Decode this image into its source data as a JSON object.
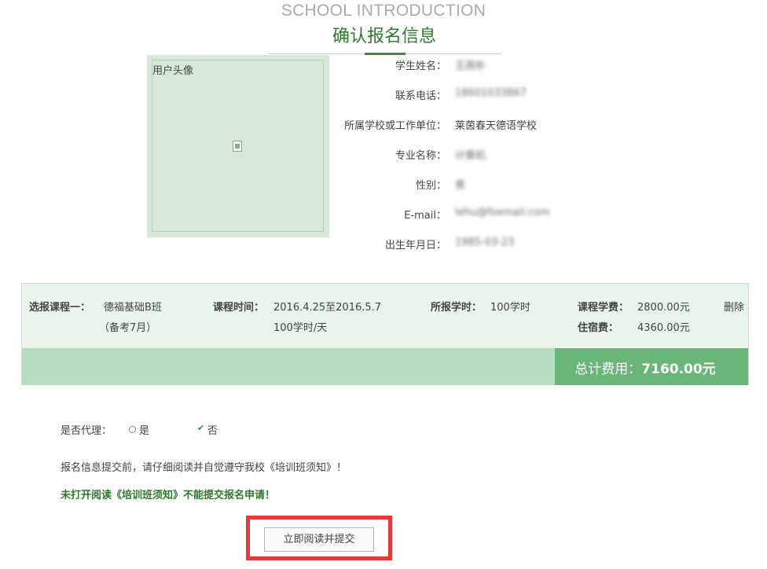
{
  "header": {
    "subtitle": "SCHOOL INTRODUCTION",
    "title": "确认报名信息"
  },
  "avatar": {
    "label": "用户头像"
  },
  "info": [
    {
      "label": "学生姓名：",
      "value": "王雨朴",
      "blurred": true
    },
    {
      "label": "联系电话：",
      "value": "18601033867",
      "blurred": true
    },
    {
      "label": "所属学校或工作单位：",
      "value": "莱茵春天德语学校",
      "blurred": false
    },
    {
      "label": "专业名称：",
      "value": "计算机",
      "blurred": true
    },
    {
      "label": "性别：",
      "value": "男",
      "blurred": true
    },
    {
      "label": "E-mail：",
      "value": "lehu@foxmail.com",
      "blurred": true
    },
    {
      "label": "出生年月日：",
      "value": "1985-03-23",
      "blurred": true
    }
  ],
  "course": {
    "course_label": "选报课程一：",
    "course_name": "德福基础B班",
    "course_note": "（备考7月）",
    "time_label": "课程时间：",
    "time_value": "2016.4.25至2016.5.7",
    "time_per_day": "100学时/天",
    "hours_label": "所报学时：",
    "hours_value": "100学时",
    "tuition_label": "课程学费：",
    "tuition_value": "2800.00元",
    "lodging_label": "住宿费：",
    "lodging_value": "4360.00元",
    "delete_label": "删除"
  },
  "total": {
    "label": "总计费用：",
    "value": "7160.00元"
  },
  "agent": {
    "label": "是否代理：",
    "yes_label": "是",
    "no_label": "否",
    "selected": "否"
  },
  "notes": {
    "read_notice": "报名信息提交前，请仔细阅读并自觉遵守我校《培训班须知》！",
    "warning": "未打开阅读《培训班须知》不能提交报名申请！"
  },
  "submit_button": {
    "label": "立即阅读并提交"
  },
  "colors": {
    "title_green": "#2f7a2f",
    "total_bg": "#68b678",
    "highlight": "#e83a3a"
  }
}
